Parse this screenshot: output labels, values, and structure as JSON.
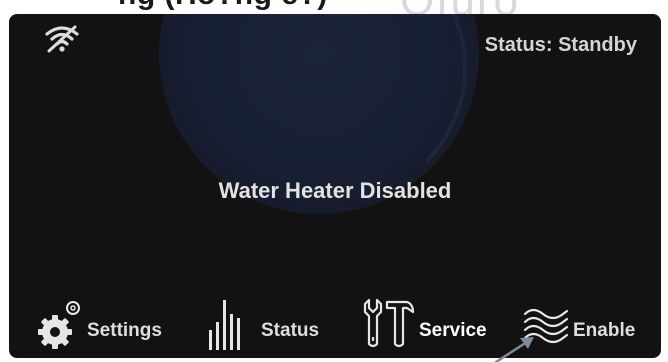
{
  "caption": {
    "partial_text": "ng (Ho?ng e?)",
    "partial_logo": "Ofuro"
  },
  "header": {
    "wifi_icon": "wifi-off-icon",
    "status": "Status: Standby"
  },
  "main": {
    "message": "Water Heater Disabled"
  },
  "nav": {
    "items": [
      {
        "label": "Settings",
        "icon": "gear-icon"
      },
      {
        "label": "Status",
        "icon": "bar-graph-icon"
      },
      {
        "label": "Service",
        "icon": "tools-icon"
      },
      {
        "label": "Enable",
        "icon": "heat-waves-icon"
      }
    ]
  },
  "colors": {
    "panel_background": "#121212",
    "text": "#dedede",
    "watermark": "#1c2438"
  }
}
